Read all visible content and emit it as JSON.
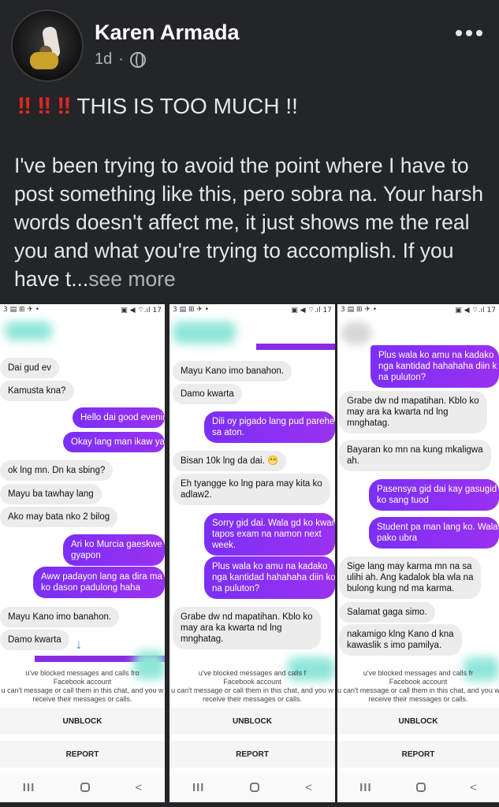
{
  "post": {
    "author": "Karen Armada",
    "time": "1d",
    "dot": "·",
    "headline_bangs": [
      "‼",
      "‼",
      "‼"
    ],
    "headline": "THIS IS TOO MUCH !!",
    "body": "I've been trying to avoid the point where I have to post something like this, pero sobra na. Your harsh words doesn't affect me, it just shows me the real you and what you're trying to accomplish. If you have t...",
    "see_more": "see more"
  },
  "shots": [
    {
      "status_left": "3 ▤ ⊞ ✈ •",
      "status_right": "▣ ◀ ⌔.ıl 17",
      "messages": [
        {
          "dir": "in",
          "text": "Dai gud ev"
        },
        {
          "dir": "in",
          "text": "Kamusta kna?"
        },
        {
          "dir": "out",
          "text": "Hello dai good evenin"
        },
        {
          "dir": "out",
          "text": "Okay lang man ikaw ya"
        },
        {
          "dir": "in",
          "text": "ok lng mn. Dn ka sbing?"
        },
        {
          "dir": "in",
          "text": "Mayu ba tawhay lang"
        },
        {
          "dir": "in",
          "text": "Ako may bata nko 2 bilog"
        },
        {
          "dir": "out",
          "text": "Ari ko Murcia gaeskwe\ngyapon"
        },
        {
          "dir": "out",
          "text": "Aww padayon lang aa dira ma\nko dason padulong haha"
        },
        {
          "dir": "in",
          "text": "Mayu Kano imo banahon."
        },
        {
          "dir": "in",
          "text": "Damo kwarta"
        }
      ],
      "scroll_icon": "↓",
      "blocked_title": "u've blocked messages and calls fro",
      "blocked_sub": "Facebook account",
      "blocked_desc": "u can't message or call them in this chat, and you w\nreceive their messages or calls.",
      "unblock": "UNBLOCK",
      "report": "REPORT"
    },
    {
      "status_left": "3 ▤ ⊞ ✈ •",
      "status_right": "▣ ◀ ⌔.ıl 17",
      "messages": [
        {
          "dir": "in",
          "text": "Mayu Kano imo banahon."
        },
        {
          "dir": "in",
          "text": "Damo kwarta"
        },
        {
          "dir": "out",
          "text": "Dili oy pigado lang pud parehe\nsa aton."
        },
        {
          "dir": "in",
          "text": "Bisan 10k lng da dai. 😁"
        },
        {
          "dir": "in",
          "text": "Eh tyangge ko lng para may kita ko\nadlaw2."
        },
        {
          "dir": "out",
          "text": "Sorry gid dai. Wala gd ko kwar\ntapos exam na namon next\nweek."
        },
        {
          "dir": "out",
          "text": "Plus wala ko amu na kadako\nnga kantidad hahahaha diin ko\nna puluton?"
        },
        {
          "dir": "in",
          "text": "Grabe dw nd mapatihan. Kblo ko\nmay ara ka kwarta nd lng\nmnghatag."
        }
      ],
      "blocked_title": "u've blocked messages and calls f",
      "blocked_sub": "Facebook account",
      "blocked_desc": "u can't message or call them in this chat, and you w\nreceive their messages or calls.",
      "unblock": "UNBLOCK",
      "report": "REPORT"
    },
    {
      "status_left": "3 ▤ ⊞ ✈ •",
      "status_right": "▣ ◀ ⌔.ıl 17",
      "messages": [
        {
          "dir": "out",
          "text": "Plus wala ko amu na kadako\nnga kantidad hahahaha diin k\nna puluton?"
        },
        {
          "dir": "in",
          "text": "Grabe dw nd mapatihan. Kblo ko\nmay ara ka kwarta nd lng\nmnghatag."
        },
        {
          "dir": "in",
          "text": "Bayaran ko mn na kung mkaligwa\nah."
        },
        {
          "dir": "out",
          "text": "Pasensya gid dai kay gasugid\nko sang tuod"
        },
        {
          "dir": "out",
          "text": "Student pa man lang ko. Wala\npako ubra"
        },
        {
          "dir": "in",
          "text": "Sige lang may karma mn na sa\nulihi ah. Ang kadalok bla wla na\nbulong kung nd ma karma."
        },
        {
          "dir": "in",
          "text": "Salamat gaga simo."
        },
        {
          "dir": "in",
          "text": "nakamigo klng Kano d kna\nkawaslik s imo pamilya."
        }
      ],
      "blocked_title": "u've blocked messages and calls fr",
      "blocked_sub": "Facebook account",
      "blocked_desc": "u can't message or call them in this chat, and you w\nreceive their messages or calls.",
      "unblock": "UNBLOCK",
      "report": "REPORT"
    }
  ],
  "nav": {
    "recent": "III",
    "home": "",
    "back": "<"
  }
}
